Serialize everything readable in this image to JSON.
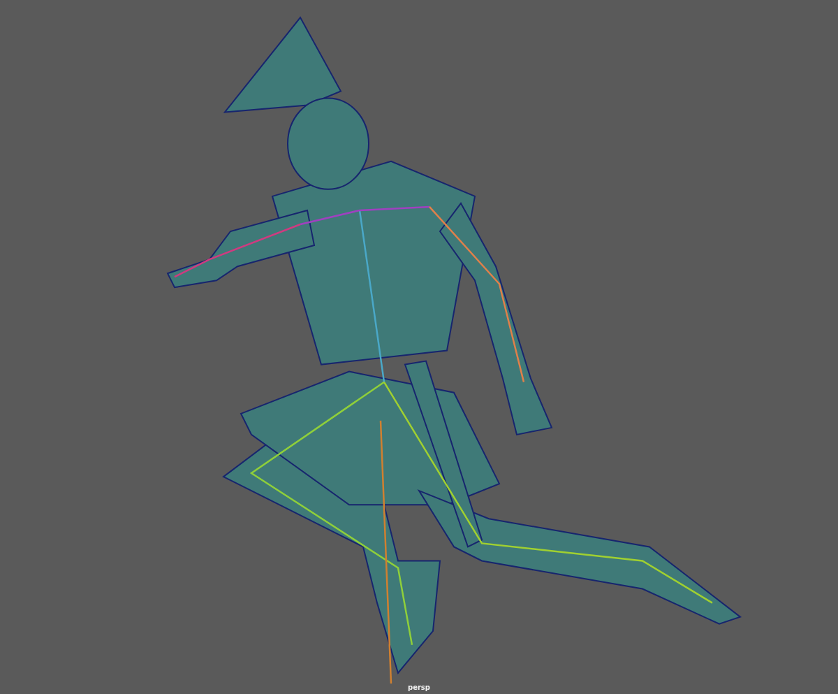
{
  "viewport": {
    "camera_label": "persp"
  }
}
